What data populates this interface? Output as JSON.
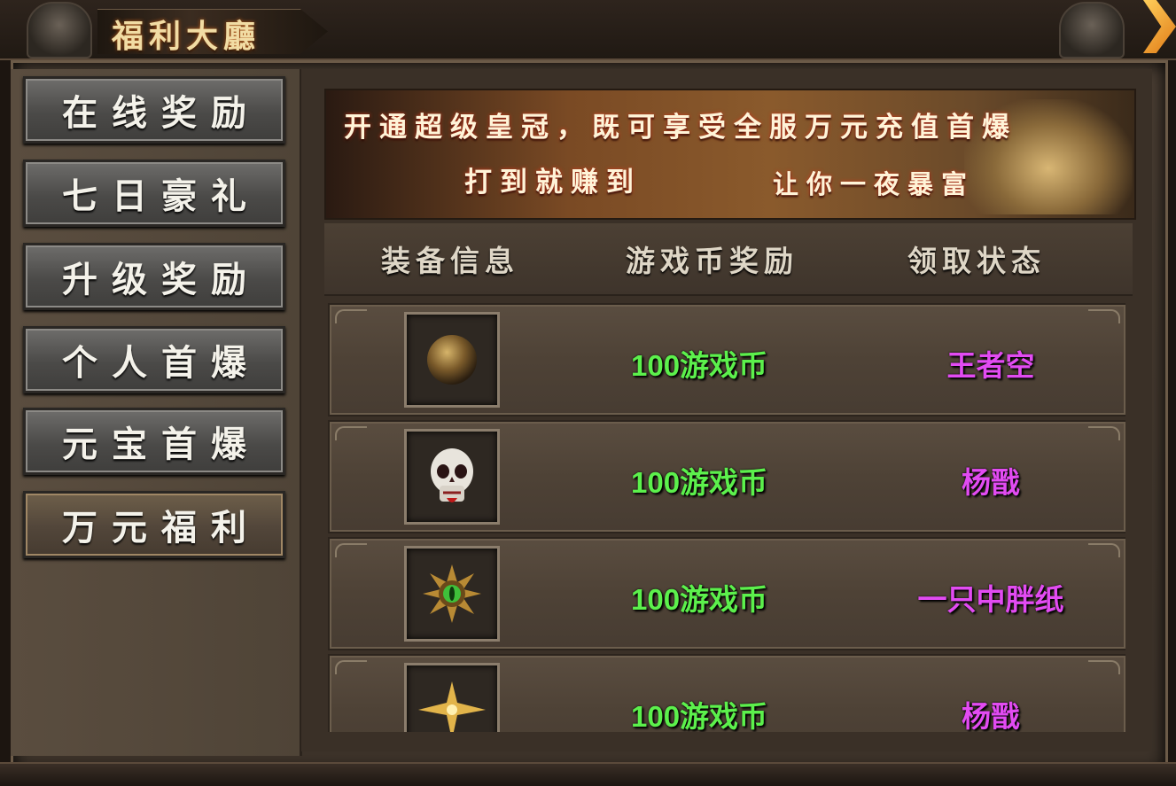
{
  "window": {
    "title": "福利大廳"
  },
  "sidebar": {
    "items": [
      {
        "label": "在线奖励",
        "active": false
      },
      {
        "label": "七日豪礼",
        "active": false
      },
      {
        "label": "升级奖励",
        "active": false
      },
      {
        "label": "个人首爆",
        "active": false
      },
      {
        "label": "元宝首爆",
        "active": false
      },
      {
        "label": "万元福利",
        "active": true
      }
    ]
  },
  "banner": {
    "line1": "开通超级皇冠，既可享受全服万元充值首爆",
    "line2a": "打到就赚到",
    "line2b": "让你一夜暴富"
  },
  "table": {
    "headers": [
      "装备信息",
      "游戏币奖励",
      "领取状态"
    ],
    "rows": [
      {
        "item_icon": "bronze-orb-icon",
        "reward": "100游戏币",
        "claimer": "王者空"
      },
      {
        "item_icon": "skull-icon",
        "reward": "100游戏币",
        "claimer": "杨戬"
      },
      {
        "item_icon": "green-eye-medallion-icon",
        "reward": "100游戏币",
        "claimer": "一只中胖纸"
      },
      {
        "item_icon": "gold-star-icon",
        "reward": "100游戏币",
        "claimer": "杨戬"
      }
    ]
  },
  "colors": {
    "reward_text": "#5cf04c",
    "claimer_text": "#e24bf2",
    "title_text": "#f1dca4",
    "close_arrow": "#f0a030"
  }
}
